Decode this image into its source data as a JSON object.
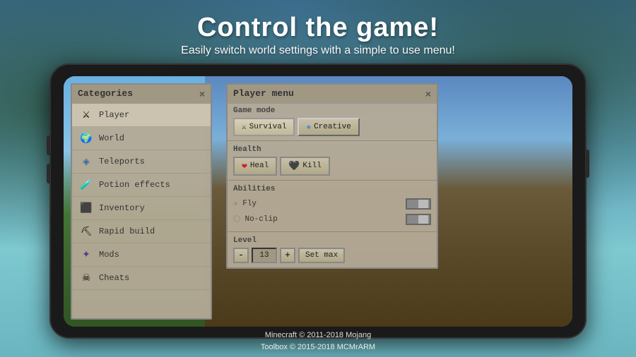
{
  "header": {
    "title": "Control the game!",
    "subtitle": "Easily switch world settings with a simple to use menu!"
  },
  "categories_panel": {
    "title": "Categories",
    "close_btn": "×",
    "items": [
      {
        "id": "player",
        "label": "Player",
        "icon": "sword",
        "active": true
      },
      {
        "id": "world",
        "label": "World",
        "icon": "globe"
      },
      {
        "id": "teleports",
        "label": "Teleports",
        "icon": "teleport"
      },
      {
        "id": "potion_effects",
        "label": "Potion effects",
        "icon": "potion"
      },
      {
        "id": "inventory",
        "label": "Inventory",
        "icon": "chest"
      },
      {
        "id": "rapid_build",
        "label": "Rapid build",
        "icon": "pickaxe"
      },
      {
        "id": "mods",
        "label": "Mods",
        "icon": "mods"
      },
      {
        "id": "cheats",
        "label": "Cheats",
        "icon": "skull"
      }
    ]
  },
  "player_panel": {
    "title": "Player menu",
    "close_btn": "×",
    "game_mode": {
      "label": "Game mode",
      "survival_btn": "Survival",
      "creative_btn": "Creative"
    },
    "health": {
      "label": "Health",
      "heal_btn": "Heal",
      "kill_btn": "Kill"
    },
    "abilities": {
      "label": "Abilities",
      "fly": {
        "label": "Fly",
        "toggle": false
      },
      "noclip": {
        "label": "No-clip",
        "toggle": false
      }
    },
    "level": {
      "label": "Level",
      "minus_btn": "-",
      "value": "13",
      "plus_btn": "+",
      "set_max_btn": "Set max"
    }
  },
  "footer": {
    "line1": "Minecraft © 2011-2018 Mojang",
    "line2": "Toolbox © 2015-2018 MCMrARM"
  }
}
